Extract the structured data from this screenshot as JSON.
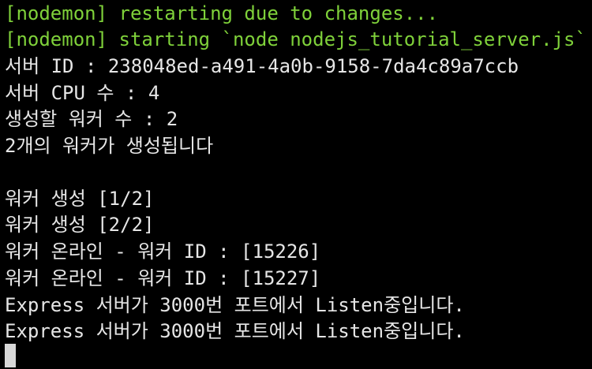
{
  "terminal": {
    "lines": [
      {
        "text": "[nodemon] restarting due to changes...",
        "color": "#7fd13a"
      },
      {
        "text": "[nodemon] starting `node nodejs_tutorial_server.js`",
        "color": "#7fd13a"
      },
      {
        "text": "서버 ID : 238048ed-a491-4a0b-9158-7da4c89a7ccb",
        "color": "#e6e6e6"
      },
      {
        "text": "서버 CPU 수 : 4",
        "color": "#e6e6e6"
      },
      {
        "text": "생성할 워커 수 : 2",
        "color": "#e6e6e6"
      },
      {
        "text": "2개의 워커가 생성됩니다",
        "color": "#e6e6e6"
      },
      {
        "text": "",
        "color": "#e6e6e6"
      },
      {
        "text": "워커 생성 [1/2]",
        "color": "#e6e6e6"
      },
      {
        "text": "워커 생성 [2/2]",
        "color": "#e6e6e6"
      },
      {
        "text": "워커 온라인 - 워커 ID : [15226]",
        "color": "#e6e6e6"
      },
      {
        "text": "워커 온라인 - 워커 ID : [15227]",
        "color": "#e6e6e6"
      },
      {
        "text": "Express 서버가 3000번 포트에서 Listen중입니다.",
        "color": "#e6e6e6"
      },
      {
        "text": "Express 서버가 3000번 포트에서 Listen중입니다.",
        "color": "#e6e6e6"
      }
    ],
    "background": "#000000",
    "cursor_color": "#d8d8d8"
  }
}
